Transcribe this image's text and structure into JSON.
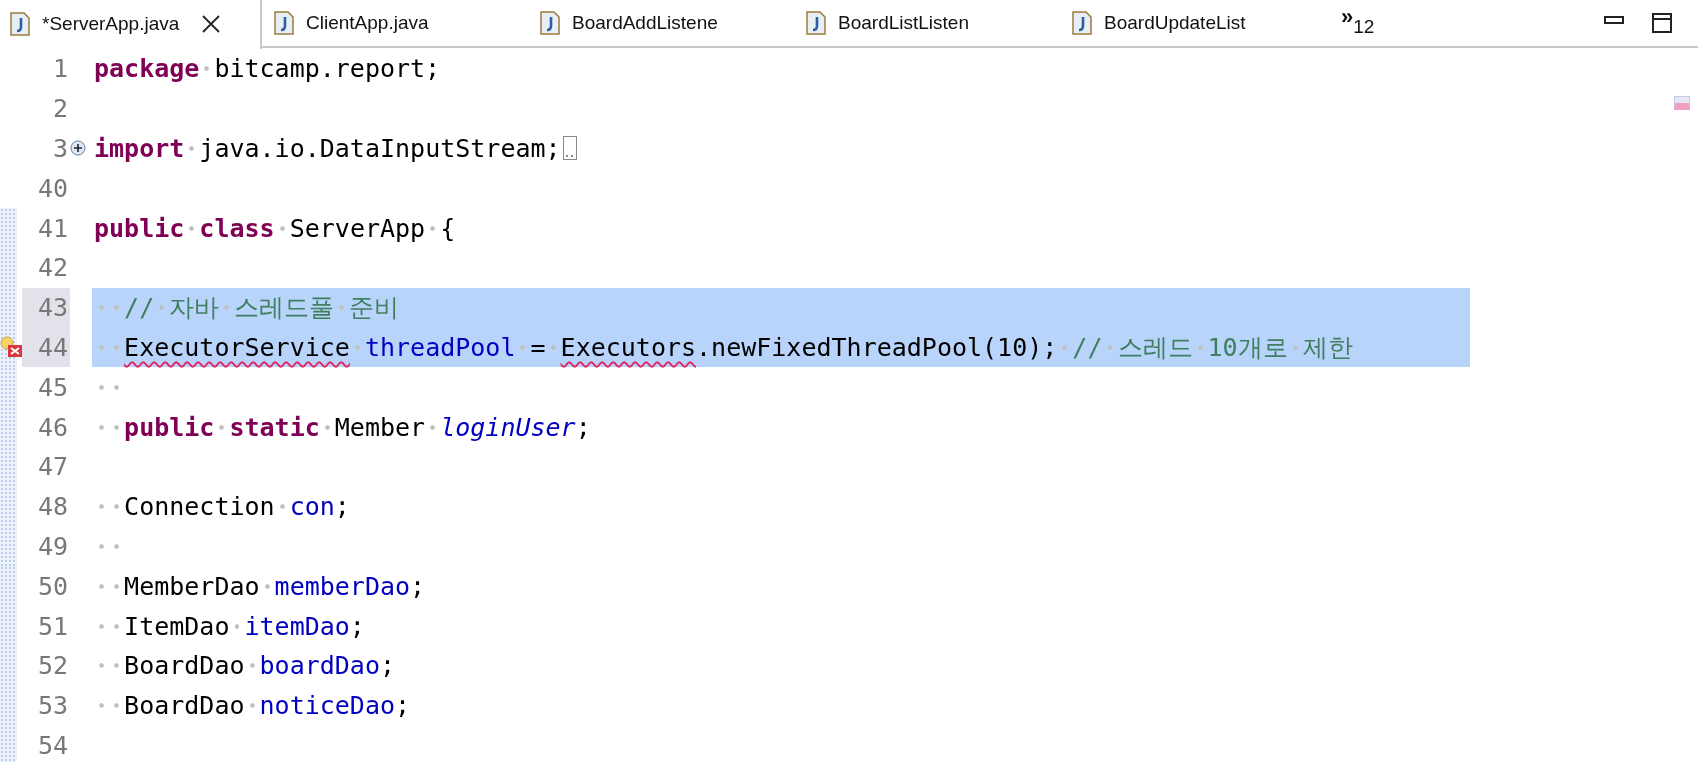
{
  "tabs": [
    {
      "label": "*ServerApp.java",
      "selected": true,
      "closable": true
    },
    {
      "label": "ClientApp.java",
      "selected": false,
      "closable": false
    },
    {
      "label": "BoardAddListene",
      "selected": false,
      "closable": false
    },
    {
      "label": "BoardListListen",
      "selected": false,
      "closable": false
    },
    {
      "label": "BoardUpdateList",
      "selected": false,
      "closable": false
    }
  ],
  "overflow": {
    "chevron": "»",
    "count": "12"
  },
  "lines": [
    {
      "number": "1",
      "selected": false,
      "changed": false,
      "collapsed": false,
      "error": false,
      "tokens": [
        {
          "kind": "kw",
          "text": "package"
        },
        {
          "kind": "ws"
        },
        {
          "kind": "plain",
          "text": "bitcamp.report;"
        }
      ]
    },
    {
      "number": "2",
      "selected": false,
      "changed": false,
      "collapsed": false,
      "error": false
    },
    {
      "number": "3",
      "selected": false,
      "changed": false,
      "collapsed": true,
      "error": false,
      "tokens": [
        {
          "kind": "kw",
          "text": "import"
        },
        {
          "kind": "ws"
        },
        {
          "kind": "plain",
          "text": "java.io.DataInputStream;"
        }
      ]
    },
    {
      "number": "40",
      "selected": false,
      "changed": false,
      "collapsed": false,
      "error": false
    },
    {
      "number": "41",
      "selected": false,
      "changed": true,
      "collapsed": false,
      "error": false,
      "tokens": [
        {
          "kind": "kw",
          "text": "public"
        },
        {
          "kind": "ws"
        },
        {
          "kind": "kw",
          "text": "class"
        },
        {
          "kind": "ws"
        },
        {
          "kind": "plain",
          "text": "ServerApp"
        },
        {
          "kind": "ws"
        },
        {
          "kind": "plain",
          "text": "{"
        }
      ]
    },
    {
      "number": "42",
      "selected": false,
      "changed": true,
      "collapsed": false,
      "error": false
    },
    {
      "number": "43",
      "selected": true,
      "changed": true,
      "collapsed": false,
      "error": false,
      "tokens": [
        {
          "kind": "ws"
        },
        {
          "kind": "ws"
        },
        {
          "kind": "comment",
          "text": "//"
        },
        {
          "kind": "ws"
        },
        {
          "kind": "comment",
          "text": "자바"
        },
        {
          "kind": "ws"
        },
        {
          "kind": "comment",
          "text": "스레드풀"
        },
        {
          "kind": "ws"
        },
        {
          "kind": "comment",
          "text": "준비"
        }
      ]
    },
    {
      "number": "44",
      "selected": true,
      "changed": true,
      "collapsed": false,
      "error": true,
      "tokens": [
        {
          "kind": "ws"
        },
        {
          "kind": "ws"
        },
        {
          "kind": "plain",
          "text": "ExecutorService",
          "error": true
        },
        {
          "kind": "ws"
        },
        {
          "kind": "field",
          "text": "threadPool"
        },
        {
          "kind": "ws"
        },
        {
          "kind": "plain",
          "text": "="
        },
        {
          "kind": "ws"
        },
        {
          "kind": "plain",
          "text": "Executors",
          "error": true
        },
        {
          "kind": "plain",
          "text": ".newFixedThreadPool(10);"
        },
        {
          "kind": "ws"
        },
        {
          "kind": "comment",
          "text": "//"
        },
        {
          "kind": "ws"
        },
        {
          "kind": "comment",
          "text": "스레드"
        },
        {
          "kind": "ws"
        },
        {
          "kind": "comment",
          "text": "10개로"
        },
        {
          "kind": "ws"
        },
        {
          "kind": "comment",
          "text": "제한"
        }
      ]
    },
    {
      "number": "45",
      "selected": false,
      "changed": true,
      "collapsed": false,
      "error": false,
      "tokens": [
        {
          "kind": "ws"
        },
        {
          "kind": "ws"
        }
      ]
    },
    {
      "number": "46",
      "selected": false,
      "changed": true,
      "collapsed": false,
      "error": false,
      "tokens": [
        {
          "kind": "ws"
        },
        {
          "kind": "ws"
        },
        {
          "kind": "kw",
          "text": "public"
        },
        {
          "kind": "ws"
        },
        {
          "kind": "kw",
          "text": "static"
        },
        {
          "kind": "ws"
        },
        {
          "kind": "plain",
          "text": "Member"
        },
        {
          "kind": "ws"
        },
        {
          "kind": "static",
          "text": "loginUser"
        },
        {
          "kind": "plain",
          "text": ";"
        }
      ]
    },
    {
      "number": "47",
      "selected": false,
      "changed": true,
      "collapsed": false,
      "error": false
    },
    {
      "number": "48",
      "selected": false,
      "changed": true,
      "collapsed": false,
      "error": false,
      "tokens": [
        {
          "kind": "ws"
        },
        {
          "kind": "ws"
        },
        {
          "kind": "plain",
          "text": "Connection"
        },
        {
          "kind": "ws"
        },
        {
          "kind": "field",
          "text": "con"
        },
        {
          "kind": "plain",
          "text": ";"
        }
      ]
    },
    {
      "number": "49",
      "selected": false,
      "changed": true,
      "collapsed": false,
      "error": false,
      "tokens": [
        {
          "kind": "ws"
        },
        {
          "kind": "ws"
        }
      ]
    },
    {
      "number": "50",
      "selected": false,
      "changed": true,
      "collapsed": false,
      "error": false,
      "tokens": [
        {
          "kind": "ws"
        },
        {
          "kind": "ws"
        },
        {
          "kind": "plain",
          "text": "MemberDao"
        },
        {
          "kind": "ws"
        },
        {
          "kind": "field",
          "text": "memberDao"
        },
        {
          "kind": "plain",
          "text": ";"
        }
      ]
    },
    {
      "number": "51",
      "selected": false,
      "changed": true,
      "collapsed": false,
      "error": false,
      "tokens": [
        {
          "kind": "ws"
        },
        {
          "kind": "ws"
        },
        {
          "kind": "plain",
          "text": "ItemDao"
        },
        {
          "kind": "ws"
        },
        {
          "kind": "field",
          "text": "itemDao"
        },
        {
          "kind": "plain",
          "text": ";"
        }
      ]
    },
    {
      "number": "52",
      "selected": false,
      "changed": true,
      "collapsed": false,
      "error": false,
      "tokens": [
        {
          "kind": "ws"
        },
        {
          "kind": "ws"
        },
        {
          "kind": "plain",
          "text": "BoardDao"
        },
        {
          "kind": "ws"
        },
        {
          "kind": "field",
          "text": "boardDao"
        },
        {
          "kind": "plain",
          "text": ";"
        }
      ]
    },
    {
      "number": "53",
      "selected": false,
      "changed": true,
      "collapsed": false,
      "error": false,
      "tokens": [
        {
          "kind": "ws"
        },
        {
          "kind": "ws"
        },
        {
          "kind": "plain",
          "text": "BoardDao"
        },
        {
          "kind": "ws"
        },
        {
          "kind": "field",
          "text": "noticeDao"
        },
        {
          "kind": "plain",
          "text": ";"
        }
      ]
    },
    {
      "number": "54",
      "selected": false,
      "changed": true,
      "collapsed": false,
      "error": false
    }
  ]
}
